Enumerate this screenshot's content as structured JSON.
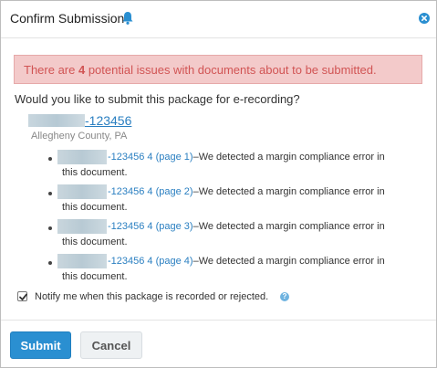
{
  "dialog": {
    "title": "Confirm Submission",
    "bell_icon": "bell-icon",
    "close_icon": "close-circle-icon"
  },
  "alert": {
    "prefix": "There are ",
    "count": "4",
    "suffix": " potential issues with documents about to be submitted."
  },
  "question": "Would you like to submit this package for e-recording?",
  "package": {
    "link": "-123456",
    "county": "Allegheny County, PA"
  },
  "issues": [
    {
      "link": "-123456 4 (page 1)",
      "line1": "–We detected a margin compliance error in",
      "line2": "this document."
    },
    {
      "link": "-123456 4 (page 2)",
      "line1": "–We detected a margin compliance error in",
      "line2": "this document."
    },
    {
      "link": "-123456 4 (page 3)",
      "line1": "–We detected a margin compliance error in",
      "line2": "this document."
    },
    {
      "link": "-123456 4 (page 4)",
      "line1": "–We detected a margin compliance error in",
      "line2": "this document."
    }
  ],
  "notify": {
    "label": "Notify me when this package is recorded or rejected.",
    "checked": true
  },
  "buttons": {
    "submit": "Submit",
    "cancel": "Cancel"
  },
  "colors": {
    "accent": "#2a8fd1",
    "link": "#2a7fc1",
    "alert_bg": "#f3caca",
    "alert_text": "#d15454"
  }
}
